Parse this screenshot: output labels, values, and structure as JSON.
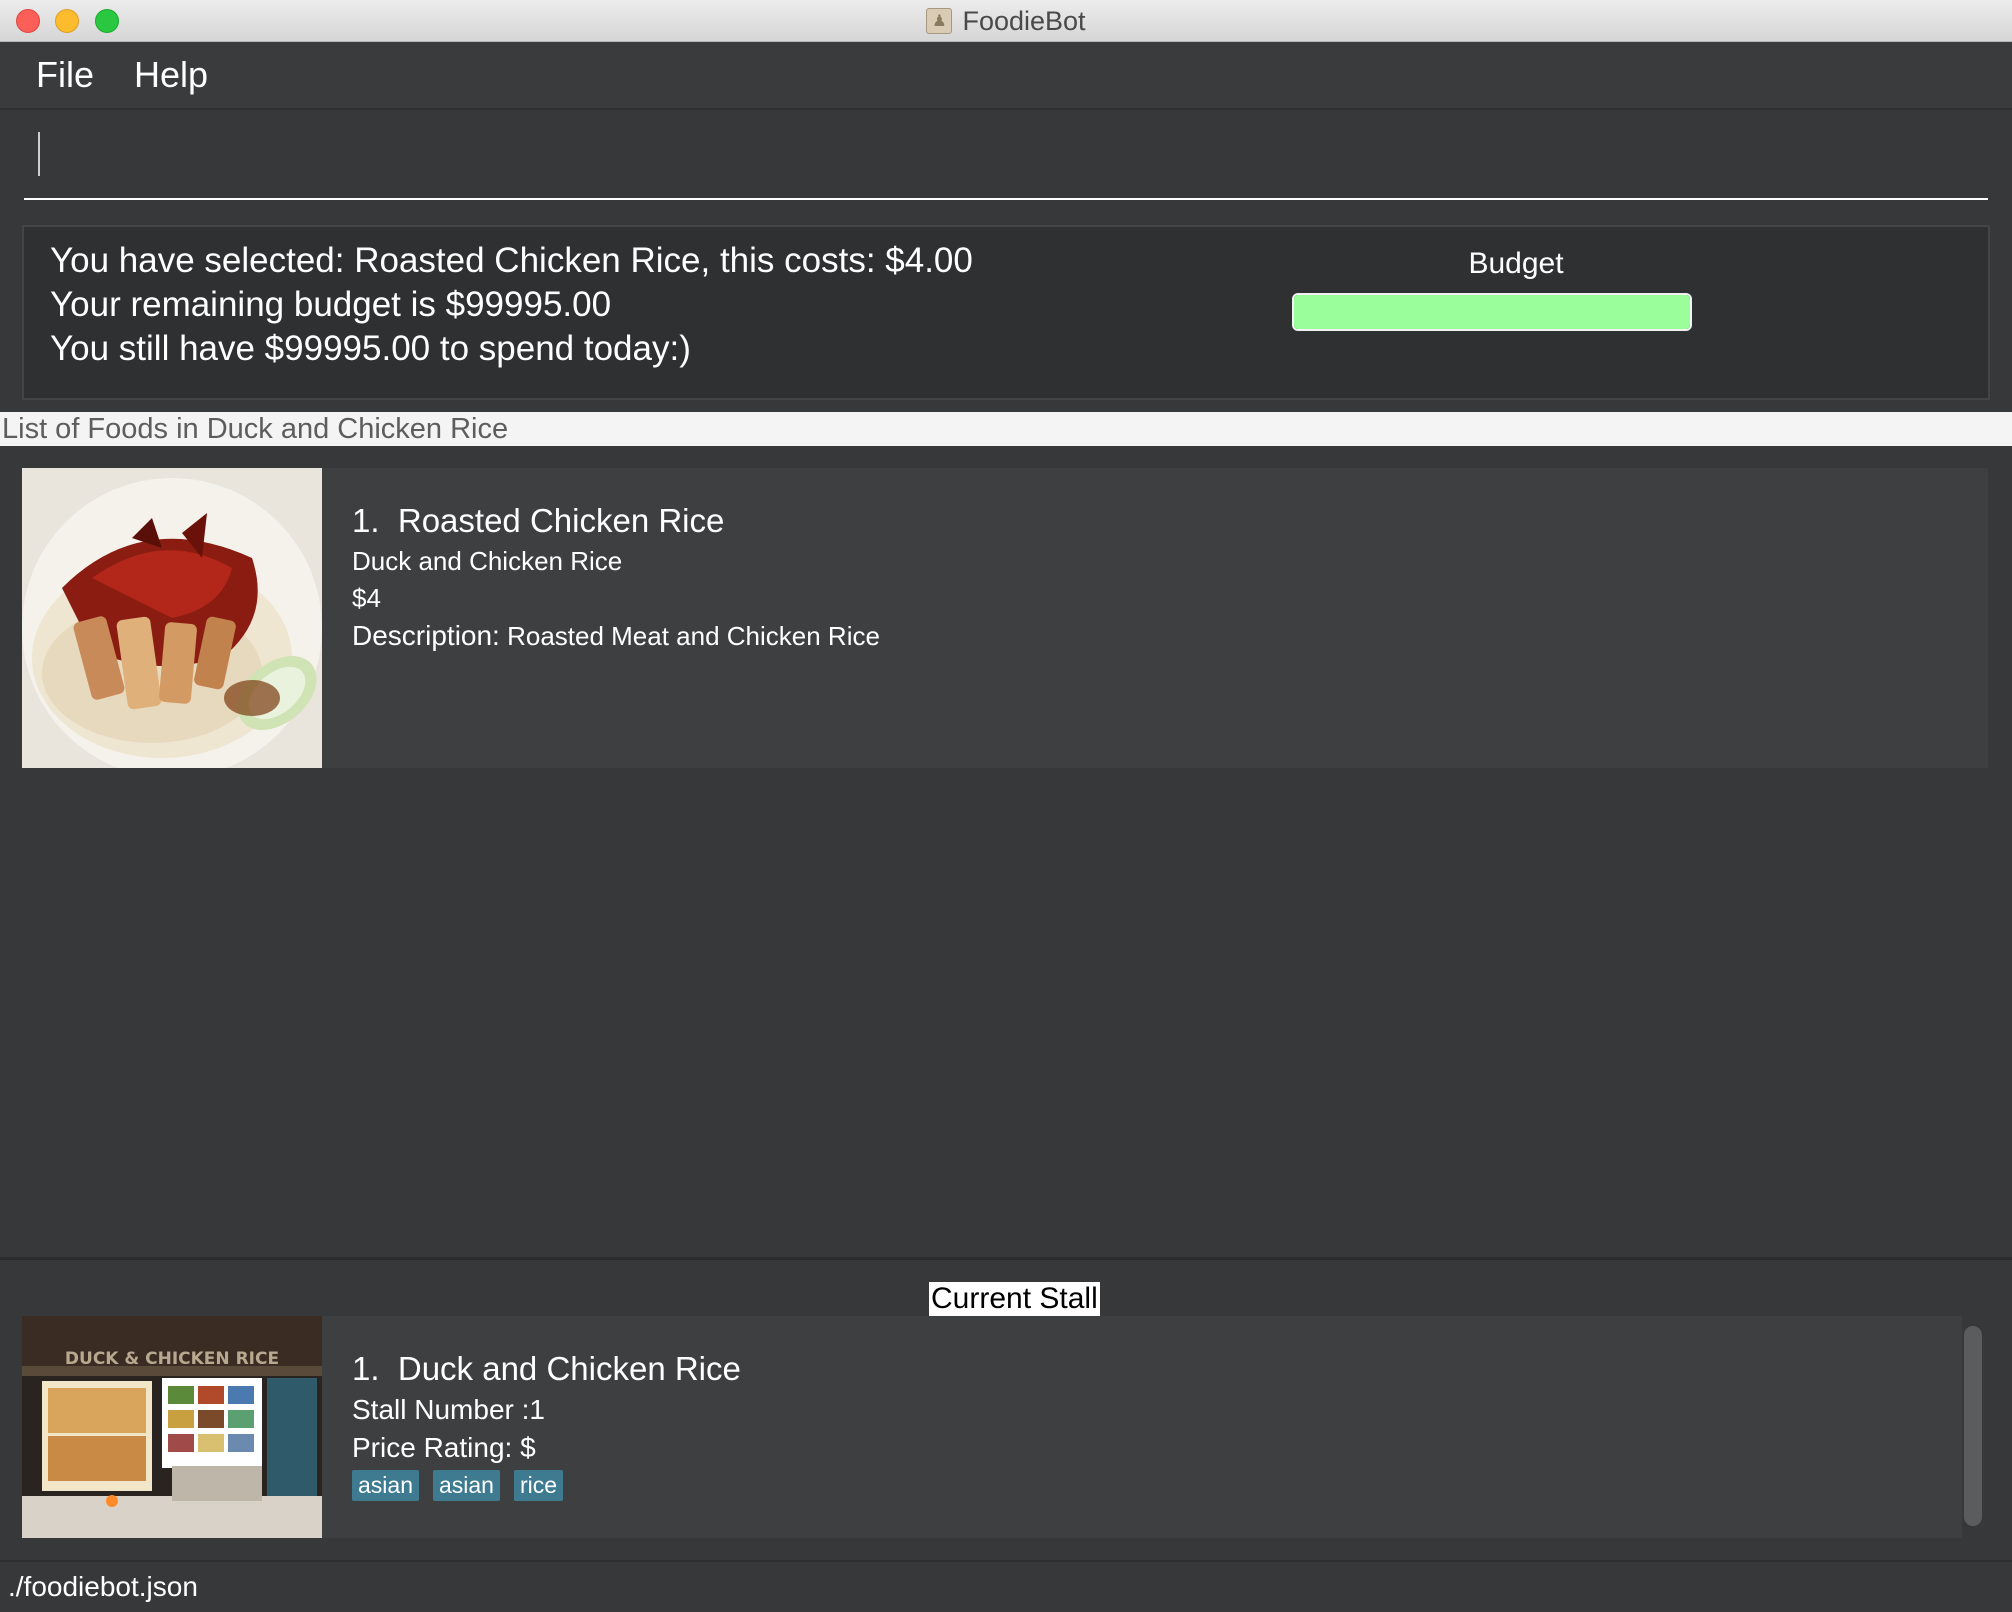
{
  "window": {
    "title": "FoodieBot"
  },
  "menu": {
    "file": "File",
    "help": "Help"
  },
  "command": {
    "value": ""
  },
  "result": {
    "line1": "You have selected: Roasted Chicken Rice, this costs: $4.00",
    "line2": "Your remaining budget is $99995.00",
    "line3": "You still have $99995.00 to spend today:)"
  },
  "budget": {
    "label": "Budget",
    "fraction": 1.0,
    "color": "#9aff9a"
  },
  "food_list": {
    "header": "List of Foods in Duck and Chicken Rice",
    "items": [
      {
        "index": "1.",
        "name": "Roasted Chicken Rice",
        "stall": "Duck and Chicken Rice",
        "price": "$4",
        "description_label": "Description:",
        "description": "Roasted Meat and Chicken Rice"
      }
    ]
  },
  "current_stall": {
    "header": "Current Stall",
    "index": "1.",
    "name": "Duck and Chicken Rice",
    "stall_number": "Stall Number :1",
    "price_rating": "Price Rating: $",
    "tags": [
      "asian",
      "asian",
      "rice"
    ],
    "sign_text": "DUCK & CHICKEN RICE"
  },
  "status": {
    "file_path": "./foodiebot.json"
  },
  "colors": {
    "tag": "#3e7b91",
    "background": "#373839",
    "card": "#3e3f41"
  }
}
